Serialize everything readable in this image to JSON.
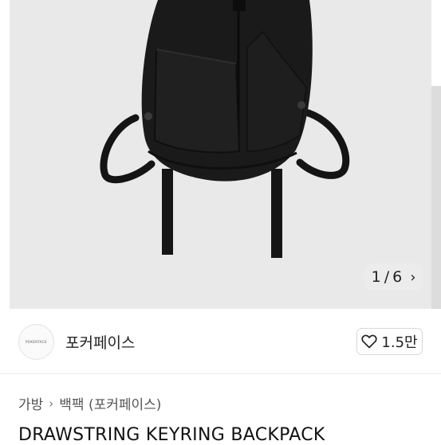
{
  "gallery": {
    "current": "1",
    "separator": "/",
    "total": "6",
    "next_icon": "chevron-right-icon"
  },
  "shop": {
    "logo_text": "POKERFACE",
    "name": "포커페이스",
    "likes": "1.5만",
    "like_icon": "heart-outline-icon"
  },
  "breadcrumb": [
    "가방",
    "백팩 (포커페이스)"
  ],
  "product": {
    "title": "DRAWSTRING KEYRING BACKPACK"
  },
  "colors": {
    "hero_bg": "#e9e9e9",
    "bag": "#1a1a1a"
  }
}
